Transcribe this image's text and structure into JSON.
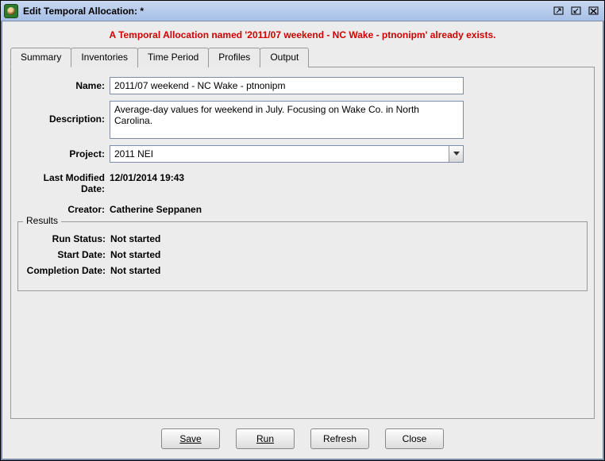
{
  "window": {
    "title": "Edit Temporal Allocation:  *"
  },
  "warning_message": "A Temporal Allocation named '2011/07 weekend - NC Wake - ptnonipm' already exists.",
  "tabs": [
    "Summary",
    "Inventories",
    "Time Period",
    "Profiles",
    "Output"
  ],
  "form": {
    "name_label": "Name:",
    "name_value": "2011/07 weekend - NC Wake - ptnonipm",
    "description_label": "Description:",
    "description_value": "Average-day values for weekend in July. Focusing on Wake Co. in North Carolina.",
    "project_label": "Project:",
    "project_value": "2011 NEI",
    "last_modified_label": "Last Modified Date:",
    "last_modified_value": "12/01/2014 19:43",
    "creator_label": "Creator:",
    "creator_value": "Catherine Seppanen"
  },
  "results": {
    "legend": "Results",
    "run_status_label": "Run Status:",
    "run_status_value": "Not started",
    "start_date_label": "Start Date:",
    "start_date_value": "Not started",
    "completion_date_label": "Completion Date:",
    "completion_date_value": "Not started"
  },
  "buttons": {
    "save": "Save",
    "run": "Run",
    "refresh": "Refresh",
    "close": "Close"
  }
}
